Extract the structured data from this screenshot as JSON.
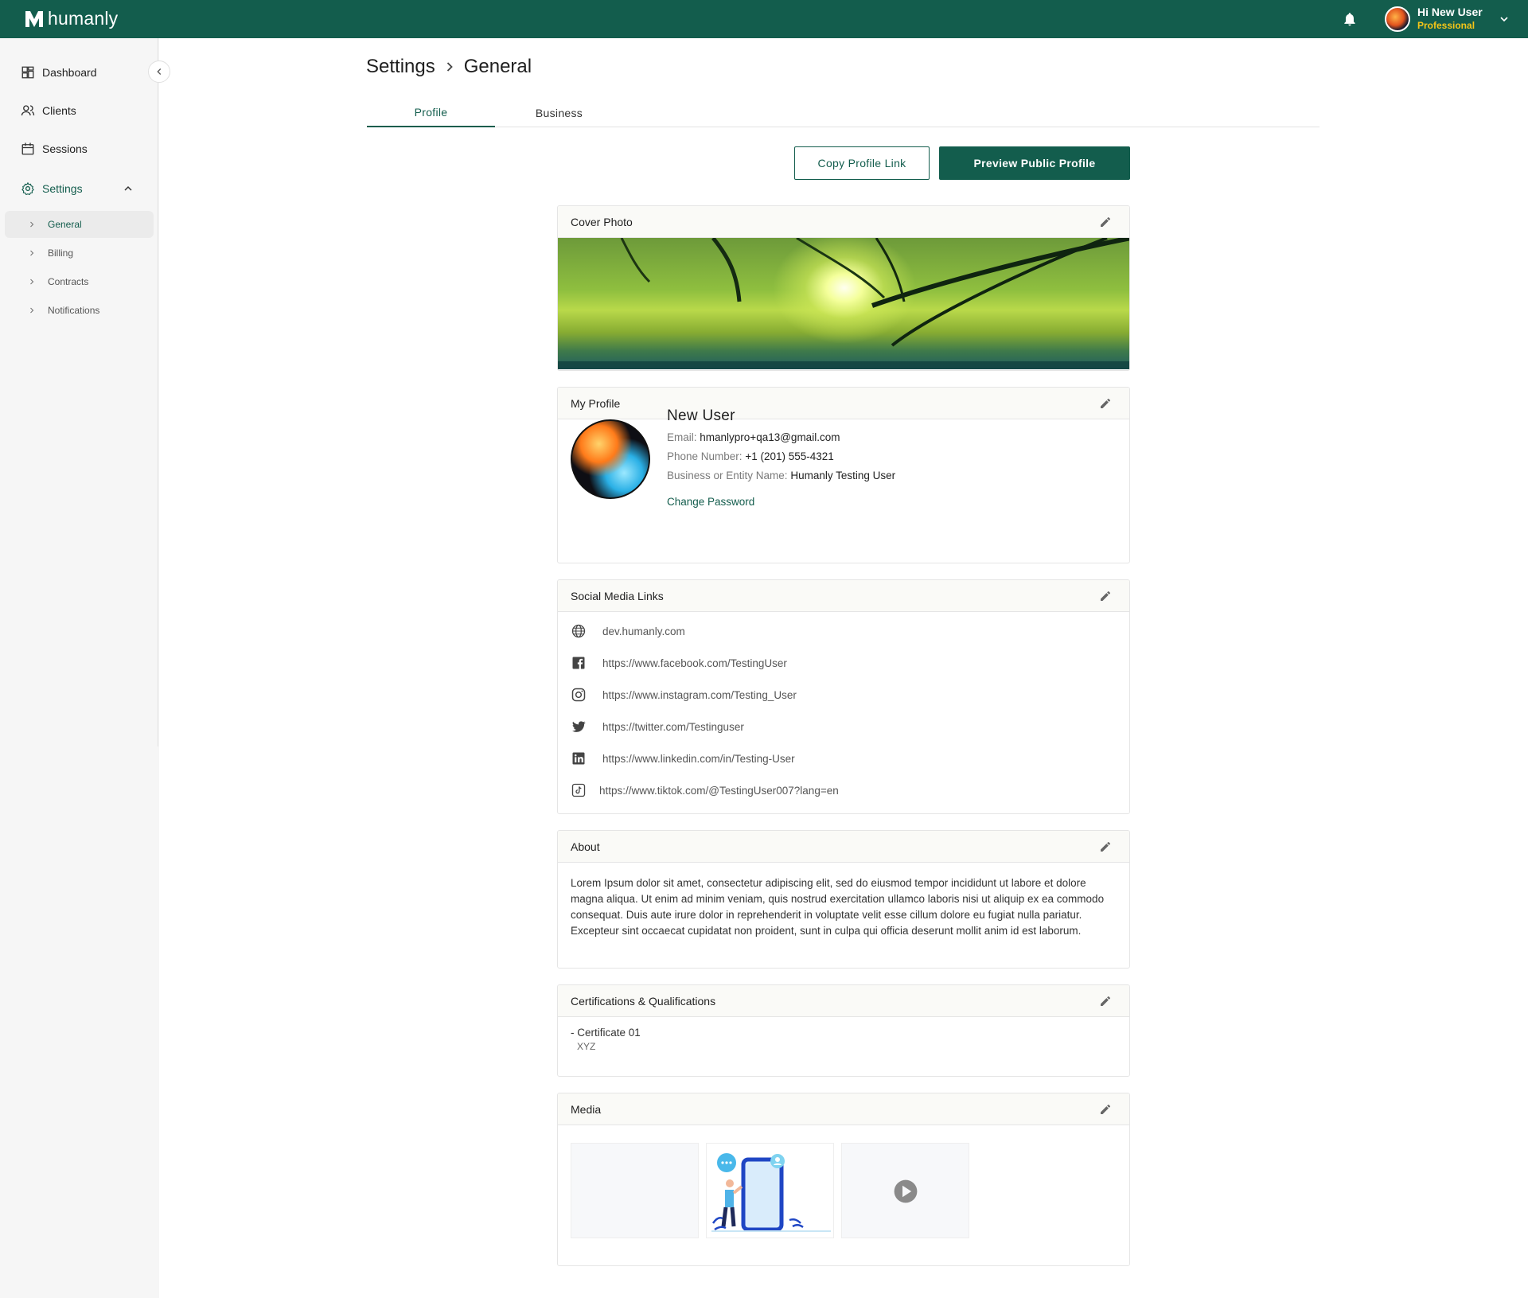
{
  "app": {
    "brand": "humanly"
  },
  "header": {
    "greeting": "Hi New User",
    "role": "Professional",
    "colors": {
      "bar": "#135d4d",
      "role": "#f5c518"
    }
  },
  "sidebar": {
    "items": [
      {
        "label": "Dashboard",
        "icon": "dashboard-icon"
      },
      {
        "label": "Clients",
        "icon": "clients-icon"
      },
      {
        "label": "Sessions",
        "icon": "calendar-icon"
      },
      {
        "label": "Settings",
        "icon": "gear-icon"
      }
    ],
    "sub_items": [
      {
        "label": "General"
      },
      {
        "label": "Billing"
      },
      {
        "label": "Contracts"
      },
      {
        "label": "Notifications"
      }
    ]
  },
  "breadcrumb": {
    "parent": "Settings",
    "current": "General"
  },
  "tabs": [
    {
      "label": "Profile"
    },
    {
      "label": "Business"
    }
  ],
  "actions": {
    "copy_link": "Copy Profile Link",
    "preview": "Preview Public Profile"
  },
  "cards": {
    "cover": {
      "title": "Cover Photo"
    },
    "profile": {
      "title": "My Profile",
      "name": "New User",
      "email_label": "Email:",
      "email": "hmanlypro+qa13@gmail.com",
      "phone_label": "Phone Number:",
      "phone": "+1 (201) 555-4321",
      "business_label": "Business or Entity Name:",
      "business": "Humanly Testing User",
      "change_password": "Change Password"
    },
    "social": {
      "title": "Social Media Links",
      "links": [
        {
          "icon": "globe-icon",
          "url": "dev.humanly.com"
        },
        {
          "icon": "facebook-icon",
          "url": "https://www.facebook.com/TestingUser"
        },
        {
          "icon": "instagram-icon",
          "url": "https://www.instagram.com/Testing_User"
        },
        {
          "icon": "twitter-icon",
          "url": "https://twitter.com/Testinguser"
        },
        {
          "icon": "linkedin-icon",
          "url": "https://www.linkedin.com/in/Testing-User"
        },
        {
          "icon": "tiktok-icon",
          "url": "https://www.tiktok.com/@TestingUser007?lang=en"
        }
      ]
    },
    "about": {
      "title": "About",
      "text": "Lorem Ipsum dolor sit amet, consectetur adipiscing elit, sed do eiusmod tempor incididunt ut labore et dolore magna aliqua. Ut enim ad minim veniam, quis nostrud exercitation ullamco laboris nisi ut aliquip ex ea commodo consequat. Duis aute irure dolor in reprehenderit in voluptate velit esse cillum dolore eu fugiat nulla pariatur. Excepteur sint occaecat cupidatat non proident, sunt in culpa qui officia deserunt mollit anim id est laborum."
    },
    "certs": {
      "title": "Certifications & Qualifications",
      "item": "- Certificate 01",
      "issuer": "XYZ"
    },
    "media": {
      "title": "Media"
    }
  }
}
